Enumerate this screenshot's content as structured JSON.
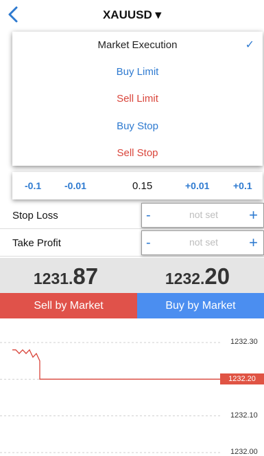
{
  "header": {
    "symbol": "XAUUSD ▾",
    "back_icon": "chevron-left-icon"
  },
  "order_type_menu": {
    "items": [
      {
        "label": "Market Execution",
        "color": "#222222",
        "selected": true
      },
      {
        "label": "Buy Limit",
        "color": "#2e7ad0",
        "selected": false
      },
      {
        "label": "Sell Limit",
        "color": "#d9453b",
        "selected": false
      },
      {
        "label": "Buy Stop",
        "color": "#2e7ad0",
        "selected": false
      },
      {
        "label": "Sell Stop",
        "color": "#d9453b",
        "selected": false
      }
    ],
    "check_glyph": "✓"
  },
  "volume": {
    "dec_large": "-0.1",
    "dec_small": "-0.01",
    "value": "0.15",
    "inc_small": "+0.01",
    "inc_large": "+0.1"
  },
  "stop_loss": {
    "label": "Stop Loss",
    "placeholder": "not set",
    "minus": "-",
    "plus": "+"
  },
  "take_profit": {
    "label": "Take Profit",
    "placeholder": "not set",
    "minus": "-",
    "plus": "+"
  },
  "prices": {
    "sell_main": "1231.",
    "sell_big": "87",
    "buy_main": "1232.",
    "buy_big": "20"
  },
  "actions": {
    "sell_label": "Sell by Market",
    "buy_label": "Buy by Market"
  },
  "colors": {
    "accent_blue": "#2e7ad0",
    "sell_red": "#e0524a",
    "buy_blue": "#4b8ef0"
  },
  "chart_data": {
    "type": "line",
    "y_ticks": [
      "1232.30",
      "1232.10",
      "1232.00"
    ],
    "current_price": "1232.20",
    "ylim": [
      1232.0,
      1232.3
    ],
    "series": [
      {
        "values": [
          1232.28,
          1232.28,
          1232.27,
          1232.28,
          1232.27,
          1232.28,
          1232.26,
          1232.27,
          1232.25,
          1232.2,
          1232.2,
          1232.2,
          1232.2,
          1232.2
        ]
      }
    ]
  }
}
